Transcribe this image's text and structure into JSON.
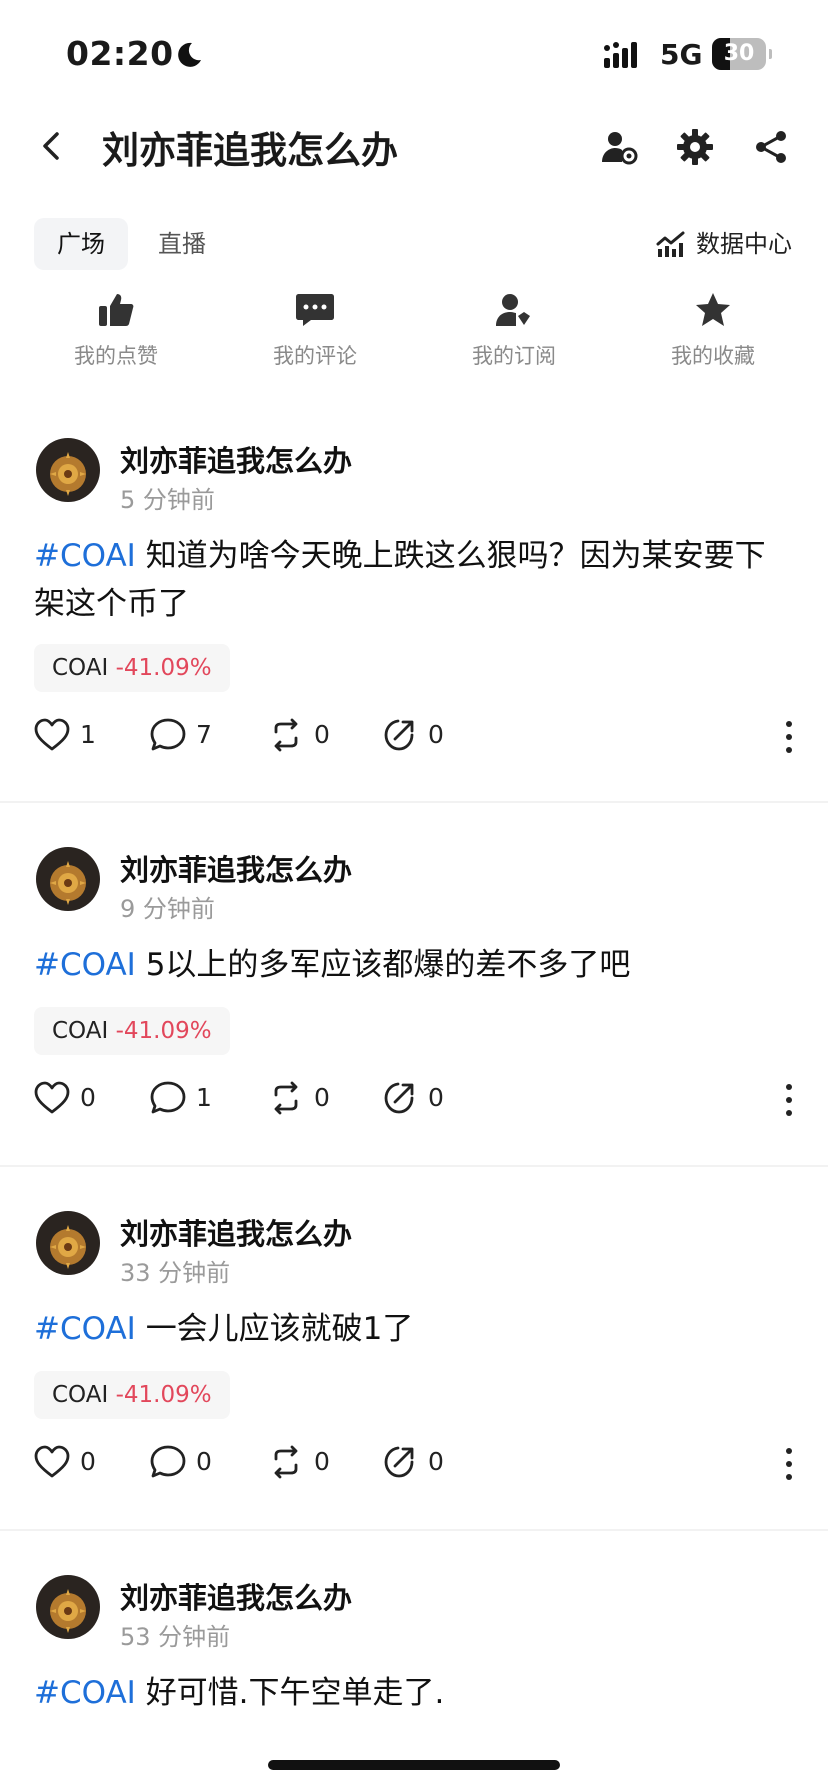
{
  "status_bar": {
    "time": "02:20",
    "network": "5G",
    "battery": "30"
  },
  "header": {
    "title": "刘亦菲追我怎么办"
  },
  "tabs": [
    {
      "label": "广场"
    },
    {
      "label": "直播"
    }
  ],
  "data_center": {
    "label": "数据中心"
  },
  "quick_actions": [
    {
      "label": "我的点赞",
      "icon": "thumbs-up-icon"
    },
    {
      "label": "我的评论",
      "icon": "comment-icon"
    },
    {
      "label": "我的订阅",
      "icon": "subscribe-icon"
    },
    {
      "label": "我的收藏",
      "icon": "star-icon"
    }
  ],
  "posts": [
    {
      "user": "刘亦菲追我怎么办",
      "time": "5 分钟前",
      "hashtag": "#COAI",
      "text": "知道为啥今天晚上跌这么狠吗？因为某安要下架这个币了",
      "ticker": "COAI",
      "change": "-41.09%",
      "likes": "1",
      "comments": "7",
      "reposts": "0",
      "shares": "0"
    },
    {
      "user": "刘亦菲追我怎么办",
      "time": "9 分钟前",
      "hashtag": "#COAI",
      "text": "5以上的多军应该都爆的差不多了吧",
      "ticker": "COAI",
      "change": "-41.09%",
      "likes": "0",
      "comments": "1",
      "reposts": "0",
      "shares": "0"
    },
    {
      "user": "刘亦菲追我怎么办",
      "time": "33 分钟前",
      "hashtag": "#COAI",
      "text": "一会儿应该就破1了",
      "ticker": "COAI",
      "change": "-41.09%",
      "likes": "0",
      "comments": "0",
      "reposts": "0",
      "shares": "0"
    },
    {
      "user": "刘亦菲追我怎么办",
      "time": "53 分钟前",
      "hashtag": "#COAI",
      "text": "好可惜.下午空单走了.",
      "ticker": "",
      "change": "",
      "likes": "",
      "comments": "",
      "reposts": "",
      "shares": ""
    }
  ],
  "colors": {
    "hashtag": "#1e6fd9",
    "negative": "#e2475b",
    "muted": "#9a9a9a"
  }
}
